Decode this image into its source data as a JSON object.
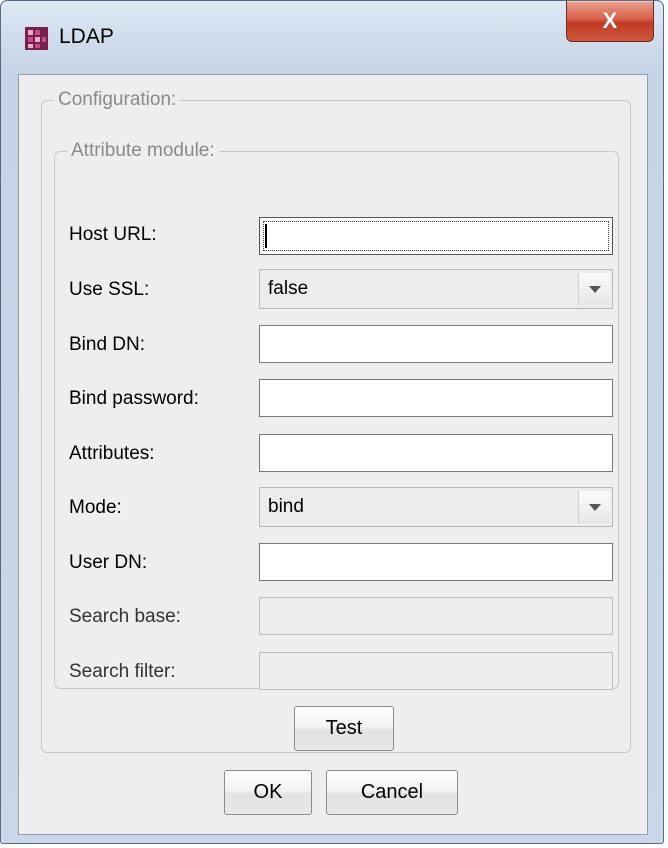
{
  "window": {
    "title": "LDAP",
    "close_label": "X",
    "icon": "app-logo-icon"
  },
  "configuration": {
    "legend": "Configuration:",
    "attribute_module": {
      "legend": "Attribute module:",
      "host_url": {
        "label": "Host URL:",
        "value": ""
      },
      "use_ssl": {
        "label": "Use SSL:",
        "value": "false"
      },
      "bind_dn": {
        "label": "Bind DN:",
        "value": ""
      },
      "bind_password": {
        "label": "Bind password:",
        "value": ""
      },
      "attributes": {
        "label": "Attributes:",
        "value": ""
      },
      "mode": {
        "label": "Mode:",
        "value": "bind"
      },
      "user_dn": {
        "label": "User DN:",
        "value": ""
      },
      "search_base": {
        "label": "Search base:",
        "value": "",
        "disabled": true
      },
      "search_filter": {
        "label": "Search filter:",
        "value": "",
        "disabled": true
      }
    },
    "test_label": "Test"
  },
  "footer": {
    "ok_label": "OK",
    "cancel_label": "Cancel"
  }
}
